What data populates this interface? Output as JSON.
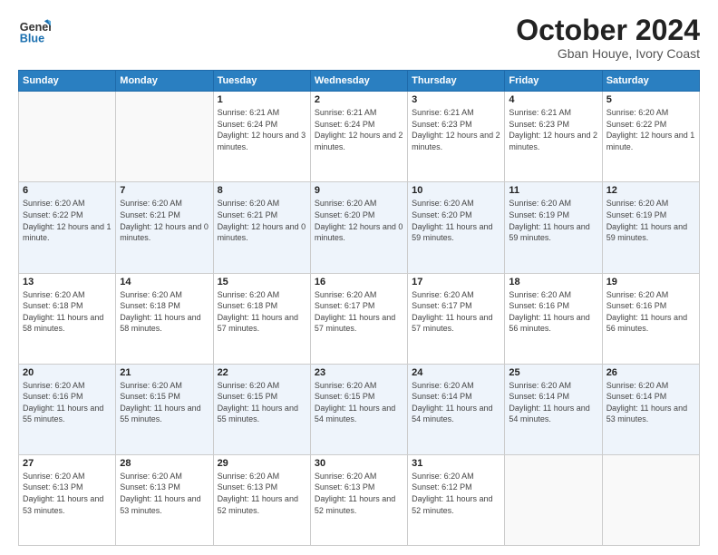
{
  "logo": {
    "text_general": "General",
    "text_blue": "Blue"
  },
  "header": {
    "month": "October 2024",
    "location": "Gban Houye, Ivory Coast"
  },
  "weekdays": [
    "Sunday",
    "Monday",
    "Tuesday",
    "Wednesday",
    "Thursday",
    "Friday",
    "Saturday"
  ],
  "weeks": [
    [
      {
        "day": "",
        "sunrise": "",
        "sunset": "",
        "daylight": ""
      },
      {
        "day": "",
        "sunrise": "",
        "sunset": "",
        "daylight": ""
      },
      {
        "day": "1",
        "sunrise": "Sunrise: 6:21 AM",
        "sunset": "Sunset: 6:24 PM",
        "daylight": "Daylight: 12 hours and 3 minutes."
      },
      {
        "day": "2",
        "sunrise": "Sunrise: 6:21 AM",
        "sunset": "Sunset: 6:24 PM",
        "daylight": "Daylight: 12 hours and 2 minutes."
      },
      {
        "day": "3",
        "sunrise": "Sunrise: 6:21 AM",
        "sunset": "Sunset: 6:23 PM",
        "daylight": "Daylight: 12 hours and 2 minutes."
      },
      {
        "day": "4",
        "sunrise": "Sunrise: 6:21 AM",
        "sunset": "Sunset: 6:23 PM",
        "daylight": "Daylight: 12 hours and 2 minutes."
      },
      {
        "day": "5",
        "sunrise": "Sunrise: 6:20 AM",
        "sunset": "Sunset: 6:22 PM",
        "daylight": "Daylight: 12 hours and 1 minute."
      }
    ],
    [
      {
        "day": "6",
        "sunrise": "Sunrise: 6:20 AM",
        "sunset": "Sunset: 6:22 PM",
        "daylight": "Daylight: 12 hours and 1 minute."
      },
      {
        "day": "7",
        "sunrise": "Sunrise: 6:20 AM",
        "sunset": "Sunset: 6:21 PM",
        "daylight": "Daylight: 12 hours and 0 minutes."
      },
      {
        "day": "8",
        "sunrise": "Sunrise: 6:20 AM",
        "sunset": "Sunset: 6:21 PM",
        "daylight": "Daylight: 12 hours and 0 minutes."
      },
      {
        "day": "9",
        "sunrise": "Sunrise: 6:20 AM",
        "sunset": "Sunset: 6:20 PM",
        "daylight": "Daylight: 12 hours and 0 minutes."
      },
      {
        "day": "10",
        "sunrise": "Sunrise: 6:20 AM",
        "sunset": "Sunset: 6:20 PM",
        "daylight": "Daylight: 11 hours and 59 minutes."
      },
      {
        "day": "11",
        "sunrise": "Sunrise: 6:20 AM",
        "sunset": "Sunset: 6:19 PM",
        "daylight": "Daylight: 11 hours and 59 minutes."
      },
      {
        "day": "12",
        "sunrise": "Sunrise: 6:20 AM",
        "sunset": "Sunset: 6:19 PM",
        "daylight": "Daylight: 11 hours and 59 minutes."
      }
    ],
    [
      {
        "day": "13",
        "sunrise": "Sunrise: 6:20 AM",
        "sunset": "Sunset: 6:18 PM",
        "daylight": "Daylight: 11 hours and 58 minutes."
      },
      {
        "day": "14",
        "sunrise": "Sunrise: 6:20 AM",
        "sunset": "Sunset: 6:18 PM",
        "daylight": "Daylight: 11 hours and 58 minutes."
      },
      {
        "day": "15",
        "sunrise": "Sunrise: 6:20 AM",
        "sunset": "Sunset: 6:18 PM",
        "daylight": "Daylight: 11 hours and 57 minutes."
      },
      {
        "day": "16",
        "sunrise": "Sunrise: 6:20 AM",
        "sunset": "Sunset: 6:17 PM",
        "daylight": "Daylight: 11 hours and 57 minutes."
      },
      {
        "day": "17",
        "sunrise": "Sunrise: 6:20 AM",
        "sunset": "Sunset: 6:17 PM",
        "daylight": "Daylight: 11 hours and 57 minutes."
      },
      {
        "day": "18",
        "sunrise": "Sunrise: 6:20 AM",
        "sunset": "Sunset: 6:16 PM",
        "daylight": "Daylight: 11 hours and 56 minutes."
      },
      {
        "day": "19",
        "sunrise": "Sunrise: 6:20 AM",
        "sunset": "Sunset: 6:16 PM",
        "daylight": "Daylight: 11 hours and 56 minutes."
      }
    ],
    [
      {
        "day": "20",
        "sunrise": "Sunrise: 6:20 AM",
        "sunset": "Sunset: 6:16 PM",
        "daylight": "Daylight: 11 hours and 55 minutes."
      },
      {
        "day": "21",
        "sunrise": "Sunrise: 6:20 AM",
        "sunset": "Sunset: 6:15 PM",
        "daylight": "Daylight: 11 hours and 55 minutes."
      },
      {
        "day": "22",
        "sunrise": "Sunrise: 6:20 AM",
        "sunset": "Sunset: 6:15 PM",
        "daylight": "Daylight: 11 hours and 55 minutes."
      },
      {
        "day": "23",
        "sunrise": "Sunrise: 6:20 AM",
        "sunset": "Sunset: 6:15 PM",
        "daylight": "Daylight: 11 hours and 54 minutes."
      },
      {
        "day": "24",
        "sunrise": "Sunrise: 6:20 AM",
        "sunset": "Sunset: 6:14 PM",
        "daylight": "Daylight: 11 hours and 54 minutes."
      },
      {
        "day": "25",
        "sunrise": "Sunrise: 6:20 AM",
        "sunset": "Sunset: 6:14 PM",
        "daylight": "Daylight: 11 hours and 54 minutes."
      },
      {
        "day": "26",
        "sunrise": "Sunrise: 6:20 AM",
        "sunset": "Sunset: 6:14 PM",
        "daylight": "Daylight: 11 hours and 53 minutes."
      }
    ],
    [
      {
        "day": "27",
        "sunrise": "Sunrise: 6:20 AM",
        "sunset": "Sunset: 6:13 PM",
        "daylight": "Daylight: 11 hours and 53 minutes."
      },
      {
        "day": "28",
        "sunrise": "Sunrise: 6:20 AM",
        "sunset": "Sunset: 6:13 PM",
        "daylight": "Daylight: 11 hours and 53 minutes."
      },
      {
        "day": "29",
        "sunrise": "Sunrise: 6:20 AM",
        "sunset": "Sunset: 6:13 PM",
        "daylight": "Daylight: 11 hours and 52 minutes."
      },
      {
        "day": "30",
        "sunrise": "Sunrise: 6:20 AM",
        "sunset": "Sunset: 6:13 PM",
        "daylight": "Daylight: 11 hours and 52 minutes."
      },
      {
        "day": "31",
        "sunrise": "Sunrise: 6:20 AM",
        "sunset": "Sunset: 6:12 PM",
        "daylight": "Daylight: 11 hours and 52 minutes."
      },
      {
        "day": "",
        "sunrise": "",
        "sunset": "",
        "daylight": ""
      },
      {
        "day": "",
        "sunrise": "",
        "sunset": "",
        "daylight": ""
      }
    ]
  ]
}
